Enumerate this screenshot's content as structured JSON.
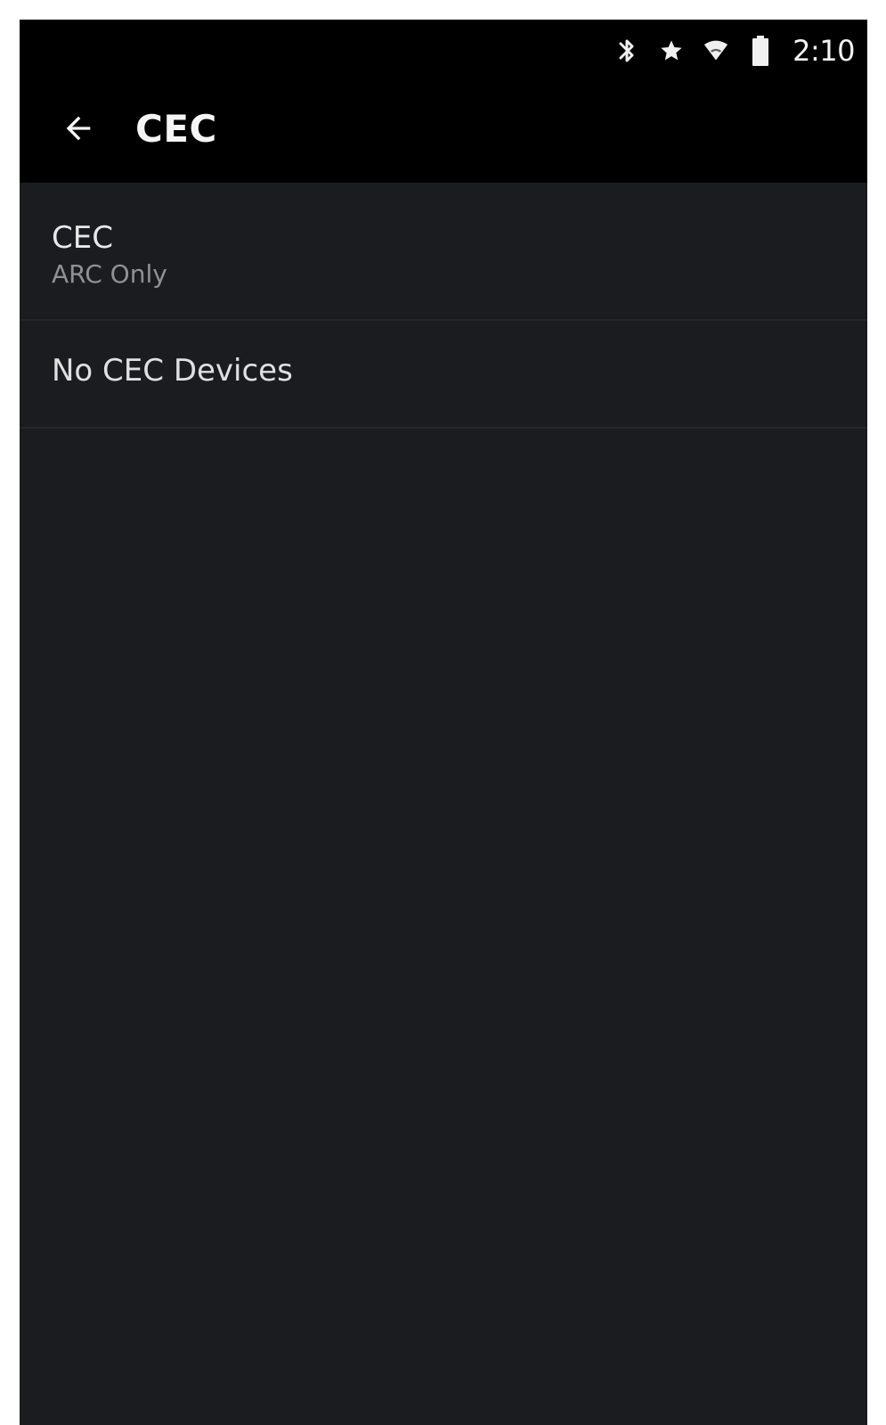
{
  "status_bar": {
    "time": "2:10",
    "icons": [
      "bluetooth-icon",
      "star-icon",
      "wifi-icon",
      "battery-icon"
    ]
  },
  "toolbar": {
    "title": "CEC",
    "back_icon": "back-arrow-icon"
  },
  "settings": {
    "cec": {
      "title": "CEC",
      "value": "ARC Only"
    },
    "devices": {
      "text": "No CEC Devices"
    }
  },
  "colors": {
    "app_bar": "#000000",
    "background": "#1a1c1f",
    "primary_text": "#e8e8e8",
    "secondary_text": "#8e9296"
  }
}
